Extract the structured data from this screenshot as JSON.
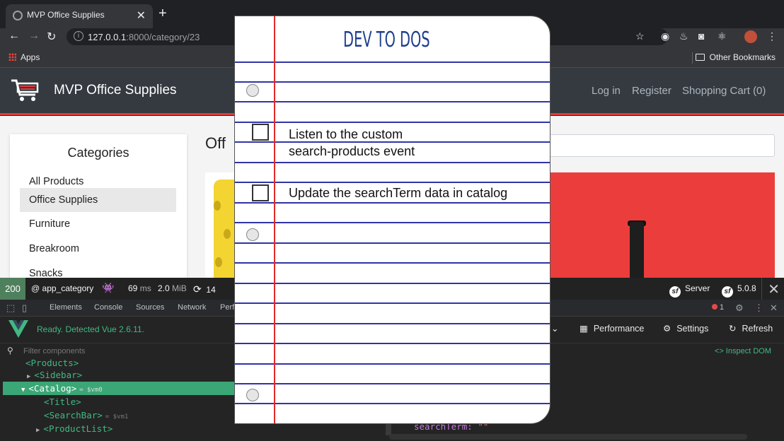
{
  "browser": {
    "tab_title": "MVP Office Supplies",
    "url_host": "127.0.0.1",
    "url_path": ":8000/category/23",
    "bookmarks": {
      "apps": "Apps",
      "other": "Other Bookmarks"
    }
  },
  "site": {
    "brand": "MVP Office Supplies",
    "nav": {
      "login": "Log in",
      "register": "Register",
      "cart": "Shopping Cart (0)"
    },
    "sidebar": {
      "heading": "Categories",
      "items": [
        {
          "label": "All Products",
          "active": false
        },
        {
          "label": "Office Supplies",
          "active": true
        },
        {
          "label": "Furniture",
          "active": false
        },
        {
          "label": "Breakroom",
          "active": false
        },
        {
          "label": "Snacks",
          "active": false
        }
      ]
    },
    "page_title_fragment": "Off"
  },
  "symfony_toolbar": {
    "status": "200",
    "route": "@ app_category",
    "time": "69",
    "time_unit": "ms",
    "memory": "2.0",
    "memory_unit": "MiB",
    "requests": "14",
    "server": "Server",
    "version": "5.0.8"
  },
  "devtools": {
    "tabs": [
      "Elements",
      "Console",
      "Sources",
      "Network",
      "Perf"
    ],
    "error_count": "1",
    "vue_status": "Ready. Detected Vue 2.6.11.",
    "vue_buttons": {
      "performance": "Performance",
      "settings": "Settings",
      "refresh": "Refresh"
    },
    "filter_placeholder": "Filter components",
    "inspect_dom": "<> Inspect DOM",
    "tree": [
      {
        "label": "<Products>",
        "indent": 1,
        "arrow": "",
        "vm": "",
        "selected": false
      },
      {
        "label": "<Sidebar>",
        "indent": 2,
        "arrow": "▶",
        "vm": "",
        "selected": false
      },
      {
        "label": "<Catalog>",
        "indent": 2,
        "arrow": "▼",
        "vm": "= $vm0",
        "selected": true
      },
      {
        "label": "<Title>",
        "indent": 3,
        "arrow": "",
        "vm": "",
        "selected": false
      },
      {
        "label": "<SearchBar>",
        "indent": 3,
        "arrow": "",
        "vm": "= $vm1",
        "selected": false
      },
      {
        "label": "<ProductList>",
        "indent": 3,
        "arrow": "▶",
        "vm": "",
        "selected": false
      }
    ],
    "state_key": "searchTerm:",
    "state_value": "\"\""
  },
  "notepad": {
    "title": "DEV TO DOS",
    "items": [
      {
        "line1": "Listen to the custom",
        "line2": "search-products event"
      },
      {
        "line1": "Update the searchTerm data in catalog",
        "line2": ""
      }
    ]
  },
  "colors": {
    "accent_red": "#e03b3b",
    "vue_green": "#42b883",
    "notepad_rule": "#3034a6",
    "notepad_margin": "#e32a2a"
  }
}
